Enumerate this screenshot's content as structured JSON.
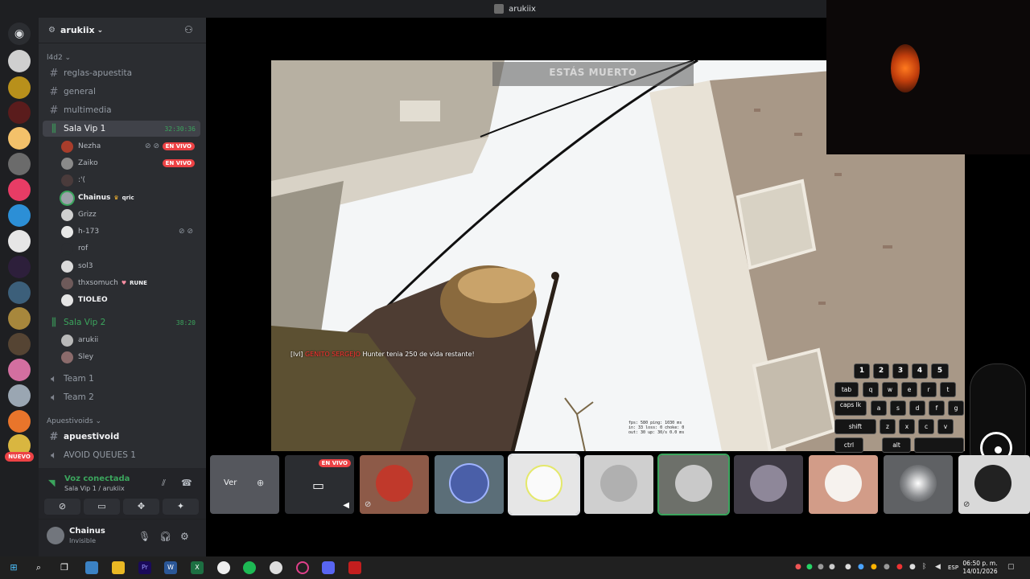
{
  "window": {
    "title": "arukiix"
  },
  "rail": {
    "new_label": "NUEVO"
  },
  "server": {
    "name": "arukiix"
  },
  "categories": [
    {
      "name": "l4d2"
    },
    {
      "name": "Apuestivoids"
    }
  ],
  "channels": [
    {
      "name": "reglas-apuestita"
    },
    {
      "name": "general"
    },
    {
      "name": "multimedia"
    },
    {
      "name": "Sala Vip 1",
      "timer": "32:30:36"
    },
    {
      "name": "Sala Vip 2",
      "timer": "38:20"
    },
    {
      "name": "Team 1"
    },
    {
      "name": "Team 2"
    },
    {
      "name": "apuestivoid"
    },
    {
      "name": "AVOID QUEUES 1"
    }
  ],
  "vip1_users": [
    {
      "name": "Nezha",
      "badge": "EN VIVO"
    },
    {
      "name": "Zaiko",
      "badge": "EN VIVO"
    },
    {
      "name": ":'("
    },
    {
      "name": "Chainus",
      "tag": "qric"
    },
    {
      "name": "Grizz"
    },
    {
      "name": "h-173"
    },
    {
      "name": "rof"
    },
    {
      "name": "sol3"
    },
    {
      "name": "thxsomuch",
      "tag": "RUNE"
    },
    {
      "name": "TIOLEO"
    }
  ],
  "vip2_users": [
    {
      "name": "arukii"
    },
    {
      "name": "Sley"
    }
  ],
  "voice": {
    "status": "Voz conectada",
    "location": "Sala Vip 1 / arukiix"
  },
  "user": {
    "name": "Chainus",
    "status": "Invisible"
  },
  "game": {
    "death_text": "ESTÁS MUERTO",
    "killfeed_level": "[lvl] ",
    "killfeed_name": "GENITO SERGEJO ",
    "killfeed_text": "Hunter tenia 250 de vida restante!",
    "stats_line1": "fps: 580   ping: 1030 ms   ",
    "stats_line2": "in: 33   loss: 0   choke: 0",
    "stats_line3": "out: 30  up: 30/s   0.0 ms"
  },
  "keyboard": {
    "nums": [
      "1",
      "2",
      "3",
      "4",
      "5"
    ],
    "tab": "tab",
    "row1": [
      "q",
      "w",
      "e",
      "r",
      "t"
    ],
    "caps": "caps lk",
    "row2": [
      "a",
      "s",
      "d",
      "f",
      "g"
    ],
    "shift": "shift",
    "row3": [
      "z",
      "x",
      "c",
      "v"
    ],
    "ctrl": "ctrl",
    "alt": "alt"
  },
  "strip": {
    "view_label": "Ver",
    "live_label": "EN VIVO"
  },
  "taskbar": {
    "language": "ESP",
    "time": "06:50 p. m.",
    "date": "14/01/2026"
  }
}
